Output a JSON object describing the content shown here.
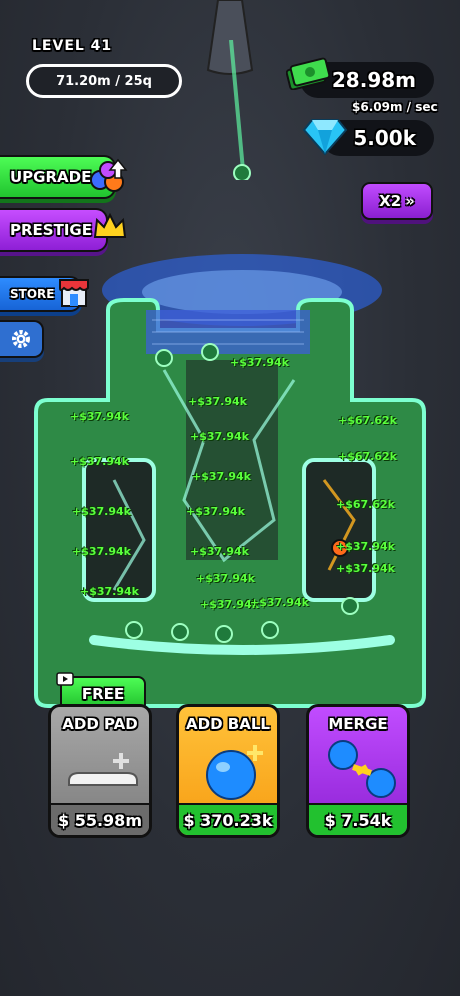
{
  "hud": {
    "level_label": "LEVEL 41",
    "progress_text": "71.20m / 25q",
    "cash_amount": "28.98m",
    "cash_rate": "$6.09m / sec",
    "gem_amount": "5.00k"
  },
  "side_buttons": {
    "upgrade_label": "UPGRADE",
    "prestige_label": "PRESTIGE",
    "store_label": "STORE"
  },
  "multiplier_label": "X2",
  "board": {
    "coin_popups": [
      "+$37.94k",
      "+$67.62k"
    ]
  },
  "shop": {
    "free_label": "FREE",
    "add_pad": {
      "title": "ADD PAD",
      "price": "$ 55.98m"
    },
    "add_ball": {
      "title": "ADD BALL",
      "price": "$ 370.23k"
    },
    "merge": {
      "title": "MERGE",
      "price": "$ 7.54k"
    }
  },
  "colors": {
    "board_green": "#39c45a",
    "cash_green": "#22c12f",
    "accent_purple": "#a23be6"
  }
}
